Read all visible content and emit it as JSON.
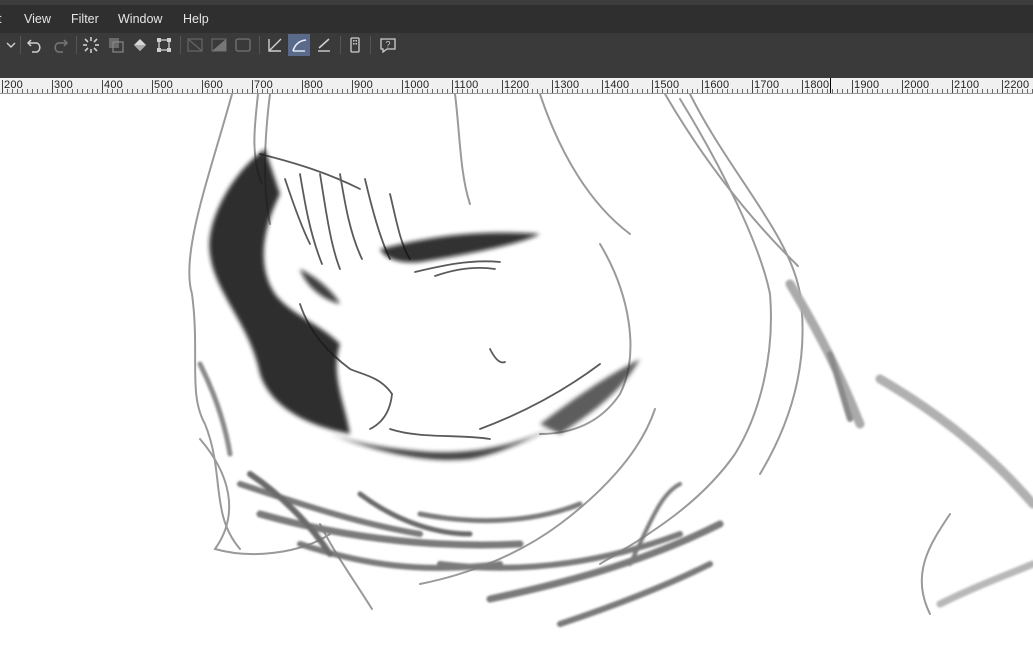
{
  "menubar": {
    "partial_item": "t",
    "items": [
      "View",
      "Filter",
      "Window",
      "Help"
    ]
  },
  "toolbar": {
    "icons": [
      "dropdown-chevron-icon",
      "undo-icon",
      "redo-icon",
      "loading-spinner-icon",
      "copy-layer-icon",
      "fill-bucket-icon",
      "transform-icon",
      "clear-icon",
      "fill-icon",
      "border-icon",
      "ruler-line-icon",
      "curve-ruler-icon",
      "pen-ruler-icon",
      "device-icon",
      "help-icon"
    ]
  },
  "ruler": {
    "labels": [
      "200",
      "300",
      "400",
      "500",
      "600",
      "700",
      "800",
      "900",
      "1000",
      "1100",
      "1200",
      "1300",
      "1400",
      "1500",
      "1600",
      "1700",
      "1800",
      "1900",
      "2000",
      "2100",
      "2200"
    ]
  },
  "colors": {
    "menubar_bg": "#2f2f2f",
    "toolbar_bg": "#3a3a3a",
    "active_tool": "#5a6a8a",
    "ruler_bg": "#f0f0f0",
    "canvas_bg": "#ffffff"
  }
}
